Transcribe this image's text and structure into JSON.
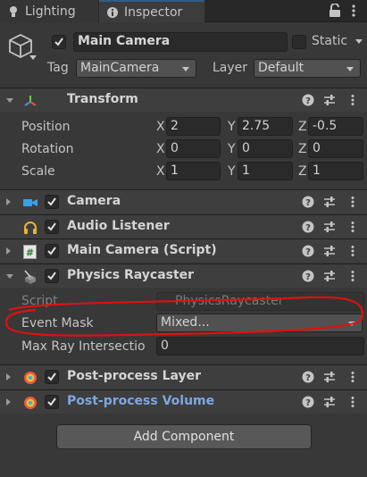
{
  "tabs": {
    "lighting": "Lighting",
    "inspector": "Inspector"
  },
  "header": {
    "name": "Main Camera",
    "static_label": "Static",
    "tag_label": "Tag",
    "tag_value": "MainCamera",
    "layer_label": "Layer",
    "layer_value": "Default"
  },
  "transform": {
    "title": "Transform",
    "rows": [
      {
        "label": "Position",
        "x": "2",
        "y": "2.75",
        "z": "-0.5"
      },
      {
        "label": "Rotation",
        "x": "0",
        "y": "0",
        "z": "0"
      },
      {
        "label": "Scale",
        "x": "1",
        "y": "1",
        "z": "1"
      }
    ],
    "axis": {
      "x": "X",
      "y": "Y",
      "z": "Z"
    }
  },
  "components": {
    "camera": "Camera",
    "audio_listener": "Audio Listener",
    "script": "Main Camera (Script)",
    "physics_raycaster": "Physics Raycaster",
    "pp_layer": "Post-process Layer",
    "pp_volume": "Post-process Volume"
  },
  "raycaster": {
    "script_label": "Script",
    "script_value": "PhysicsRaycaster",
    "event_mask_label": "Event Mask",
    "event_mask_value": "Mixed...",
    "max_ray_label": "Max Ray Intersectio",
    "max_ray_value": "0"
  },
  "add_component": "Add Component",
  "colors": {
    "annotation": "#e01010",
    "accent_blue": "#7ea6e0",
    "tab_accent": "#2c5d87"
  }
}
